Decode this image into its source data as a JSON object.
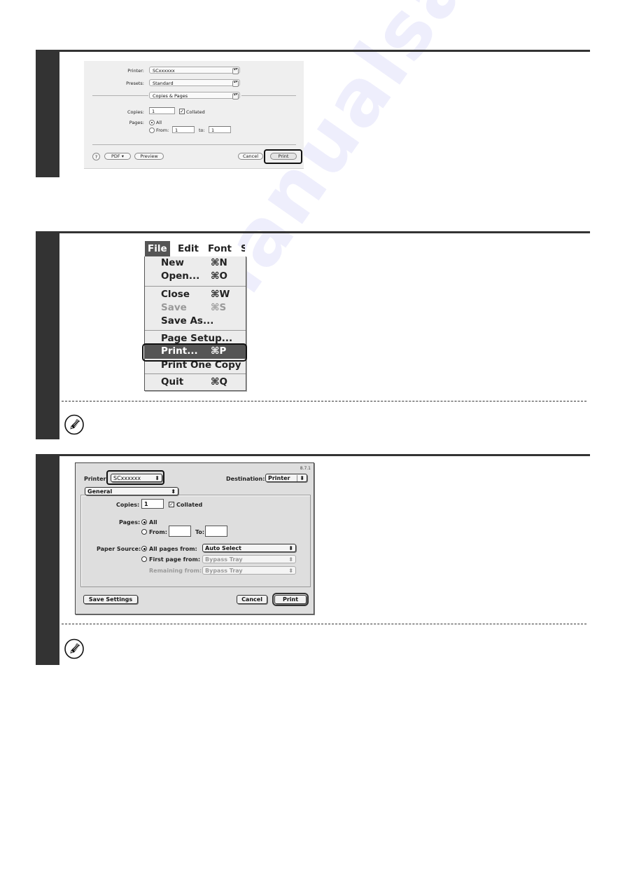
{
  "steps": [
    {
      "id": 1,
      "dialog": {
        "printer_label": "Printer:",
        "printer_value": "SCxxxxxx",
        "presets_label": "Presets:",
        "presets_value": "Standard",
        "panel_value": "Copies & Pages",
        "copies_label": "Copies:",
        "copies_value": "1",
        "collated_label": "Collated",
        "collated_checked": true,
        "pages_label": "Pages:",
        "all_label": "All",
        "from_label": "From:",
        "from_value": "1",
        "to_label": "to:",
        "to_value": "1",
        "help_label": "?",
        "pdf_label": "PDF ▾",
        "preview_label": "Preview",
        "cancel_label": "Cancel",
        "print_label": "Print"
      }
    },
    {
      "id": 2,
      "menubar": [
        "File",
        "Edit",
        "Font",
        "S"
      ],
      "menu_items": [
        {
          "label": "New",
          "shortcut": "⌘N",
          "disabled": false
        },
        {
          "label": "Open...",
          "shortcut": "⌘O",
          "disabled": false
        },
        {
          "label": "Close",
          "shortcut": "⌘W",
          "disabled": false
        },
        {
          "label": "Save",
          "shortcut": "⌘S",
          "disabled": true
        },
        {
          "label": "Save As...",
          "shortcut": "",
          "disabled": false
        },
        {
          "label": "Page Setup...",
          "shortcut": "",
          "disabled": false
        },
        {
          "label": "Print...",
          "shortcut": "⌘P",
          "disabled": false,
          "selected": true
        },
        {
          "label": "Print One Copy",
          "shortcut": "",
          "disabled": false
        },
        {
          "label": "Quit",
          "shortcut": "⌘Q",
          "disabled": false
        }
      ]
    },
    {
      "id": 3,
      "dialog": {
        "version": "8.7.1",
        "printer_label": "Printer:",
        "printer_value": "SCxxxxxx",
        "destination_label": "Destination:",
        "destination_value": "Printer",
        "panel_value": "General",
        "copies_label": "Copies:",
        "copies_value": "1",
        "collated_label": "Collated",
        "collated_checked": true,
        "pages_label": "Pages:",
        "all_label": "All",
        "from_label": "From:",
        "from_value": "",
        "to_label": "To:",
        "to_value": "",
        "paper_source_label": "Paper Source:",
        "all_pages_from_label": "All pages from:",
        "all_pages_from_value": "Auto Select",
        "first_page_from_label": "First page from:",
        "first_page_from_value": "Bypass Tray",
        "remaining_from_label": "Remaining from:",
        "remaining_from_value": "Bypass Tray",
        "save_settings_label": "Save Settings",
        "cancel_label": "Cancel",
        "print_label": "Print"
      }
    }
  ],
  "icons": {
    "note": "pencil-note-icon",
    "popup_arrows": "↕",
    "checkmark": "✓"
  },
  "watermark": "manualsarchive"
}
